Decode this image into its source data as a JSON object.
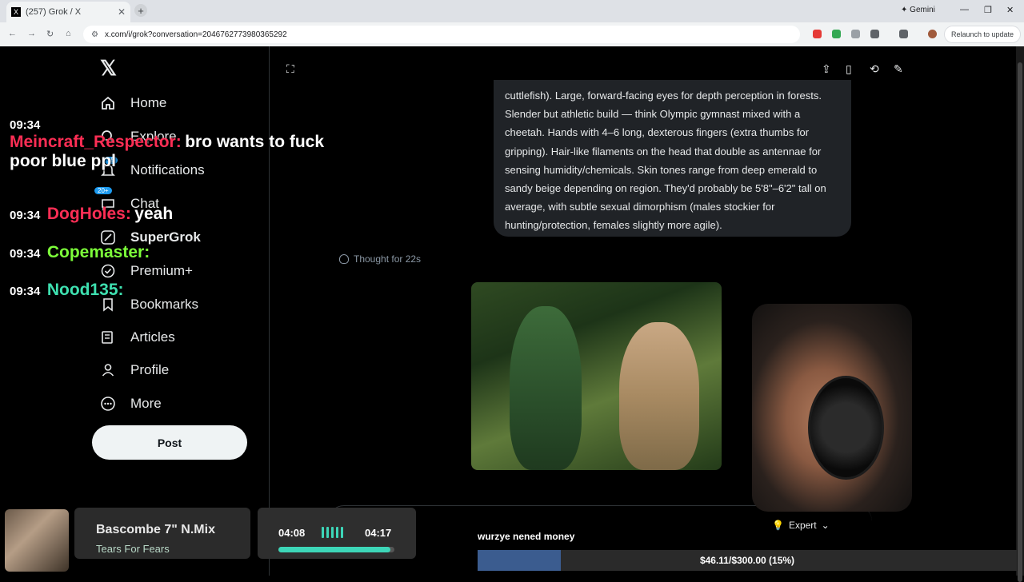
{
  "browser": {
    "tab_title": "(257) Grok / X",
    "url": "x.com/i/grok?conversation=2046762773980365292",
    "gemini_label": "Gemini",
    "relaunch_label": "Relaunch to update"
  },
  "sidebar": {
    "items": [
      {
        "label": "Home",
        "icon": "home-icon"
      },
      {
        "label": "Explore",
        "icon": "search-icon"
      },
      {
        "label": "Notifications",
        "icon": "bell-icon",
        "badge": "15"
      },
      {
        "label": "Chat",
        "icon": "chat-icon",
        "badge": "20+"
      },
      {
        "label": "SuperGrok",
        "icon": "grok-icon"
      },
      {
        "label": "Premium+",
        "icon": "verified-icon"
      },
      {
        "label": "Bookmarks",
        "icon": "bookmark-icon"
      },
      {
        "label": "Articles",
        "icon": "article-icon"
      },
      {
        "label": "Profile",
        "icon": "person-icon"
      },
      {
        "label": "More",
        "icon": "more-icon"
      }
    ],
    "post_label": "Post"
  },
  "chat_bubble": {
    "text": "cuttlefish). Large, forward-facing eyes for depth perception in forests. Slender but athletic build — think Olympic gymnast mixed with a cheetah. Hands with 4–6 long, dexterous fingers (extra thumbs for gripping). Hair-like filaments on the head that double as antennae for sensing humidity/chemicals. Skin tones range from deep emerald to sandy beige depending on region. They'd probably be 5'8\"–6'2\" tall on average, with subtle sexual dimorphism (males stockier for hunting/protection, females slightly more agile)."
  },
  "thought": "Thought for 22s",
  "composer": {
    "mode": "Expert"
  },
  "stream_chat": [
    {
      "time": "09:34",
      "user": "Meincraft_Respector:",
      "text": "bro wants to fuck poor blue ppl",
      "color": "#ff2e55"
    },
    {
      "time": "09:34",
      "user": "DogHoles:",
      "text": "yeah",
      "color": "#ff2e55"
    },
    {
      "time": "09:34",
      "user": "Copemaster:",
      "text": "",
      "color": "#7dff3a"
    },
    {
      "time": "09:34",
      "user": "Nood135:",
      "text": "",
      "color": "#3ee0b0"
    }
  ],
  "now_playing": {
    "title": "Bascombe 7\" N.Mix",
    "artist": "Tears For Fears",
    "current": "04:08",
    "total": "04:17",
    "progress": 0.965
  },
  "donation_goal": {
    "label": "wurzye nened money",
    "text": "$46.11/$300.00 (15%)",
    "progress": 0.154
  }
}
